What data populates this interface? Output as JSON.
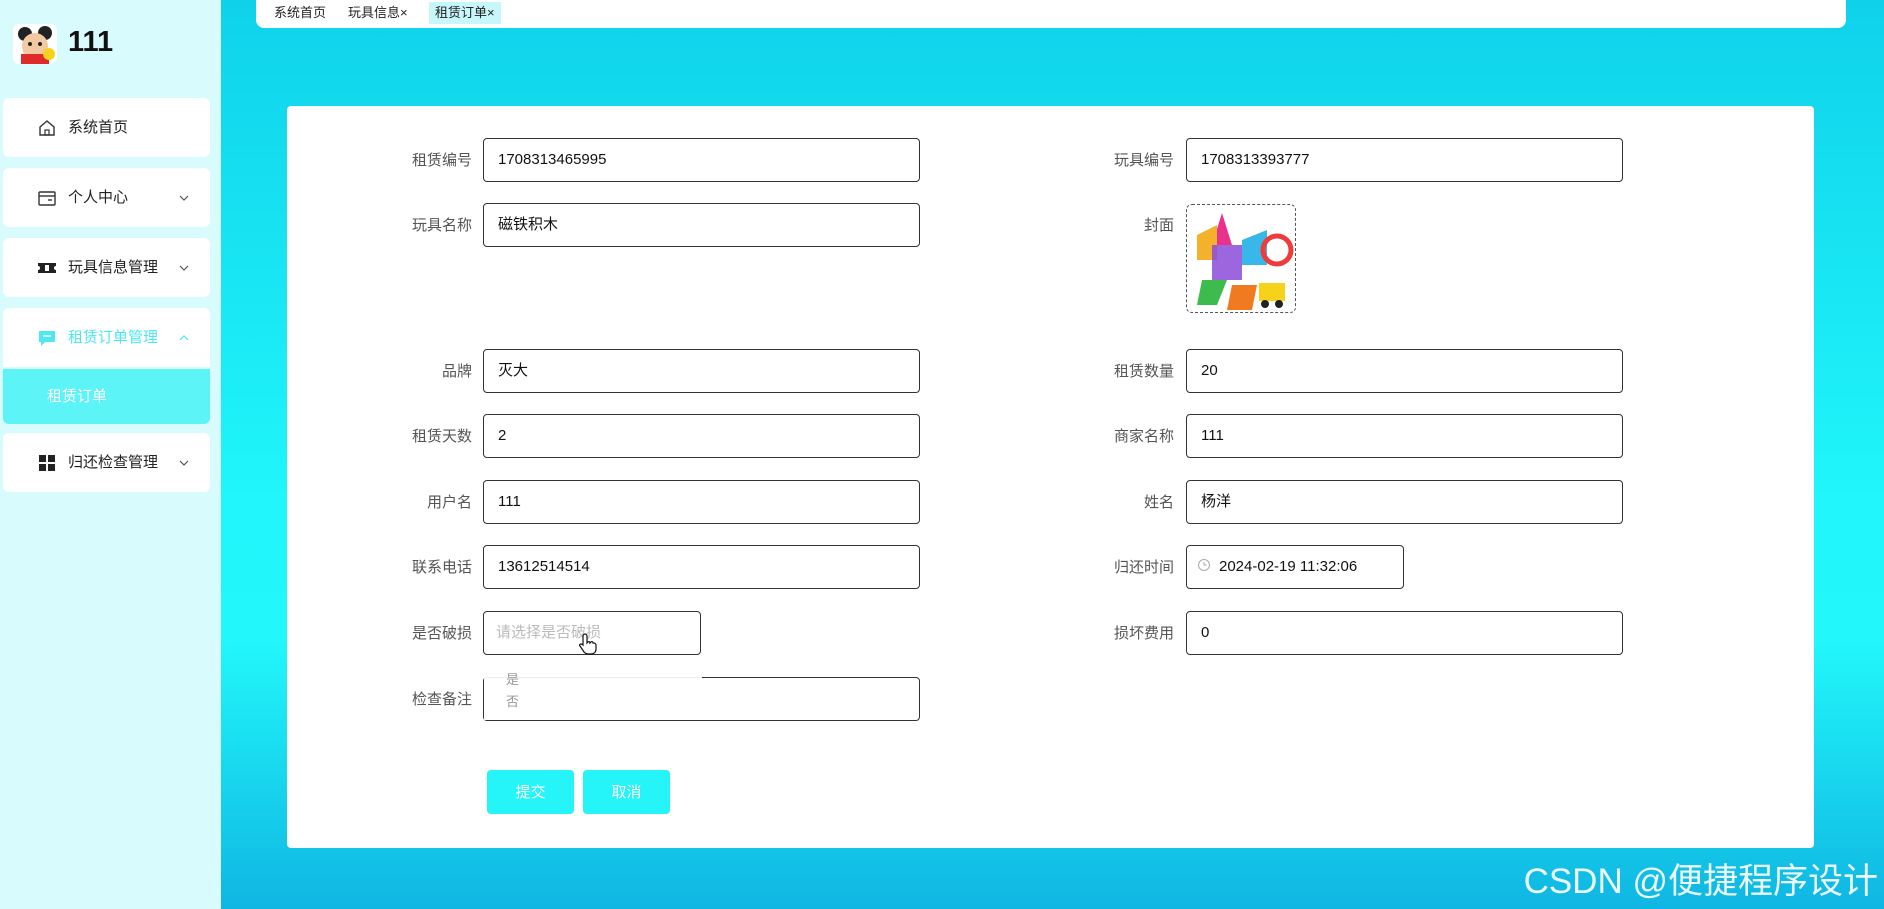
{
  "app": {
    "title": "111"
  },
  "sidebar": {
    "items": [
      {
        "label": "系统首页",
        "icon": "home-icon"
      },
      {
        "label": "个人中心",
        "icon": "wallet-icon"
      },
      {
        "label": "玩具信息管理",
        "icon": "ticket-icon"
      },
      {
        "label": "租赁订单管理",
        "icon": "chat-icon"
      },
      {
        "label": "归还检查管理",
        "icon": "grid-icon"
      }
    ],
    "submenu": {
      "label": "租赁订单"
    }
  },
  "tabs": [
    "系统首页",
    "玩具信息",
    "租赁订单"
  ],
  "tab_close": "×",
  "form": {
    "rental_no": {
      "label": "租赁编号",
      "value": "1708313465995"
    },
    "toy_no": {
      "label": "玩具编号",
      "value": "1708313393777"
    },
    "toy_name": {
      "label": "玩具名称",
      "value": "磁铁积木"
    },
    "cover": {
      "label": "封面"
    },
    "brand": {
      "label": "品牌",
      "value": "灭大"
    },
    "quantity": {
      "label": "租赁数量",
      "value": "20"
    },
    "days": {
      "label": "租赁天数",
      "value": "2"
    },
    "merchant": {
      "label": "商家名称",
      "value": "111"
    },
    "username": {
      "label": "用户名",
      "value": "111"
    },
    "name": {
      "label": "姓名",
      "value": "杨洋"
    },
    "phone": {
      "label": "联系电话",
      "value": "13612514514"
    },
    "return_time": {
      "label": "归还时间",
      "value": "2024-02-19 11:32:06"
    },
    "damaged": {
      "label": "是否破损",
      "placeholder": "请选择是否破损",
      "options": [
        "是",
        "否"
      ]
    },
    "damage_fee": {
      "label": "损坏费用",
      "value": "0"
    },
    "remark": {
      "label": "检查备注",
      "value": ""
    }
  },
  "buttons": {
    "submit": "提交",
    "cancel": "取消"
  },
  "watermark": "CSDN @便捷程序设计",
  "colors": {
    "accent": "#25f5f9",
    "sidebar_bg": "#d8fbfd",
    "main_bg": "#0fd8ee"
  }
}
